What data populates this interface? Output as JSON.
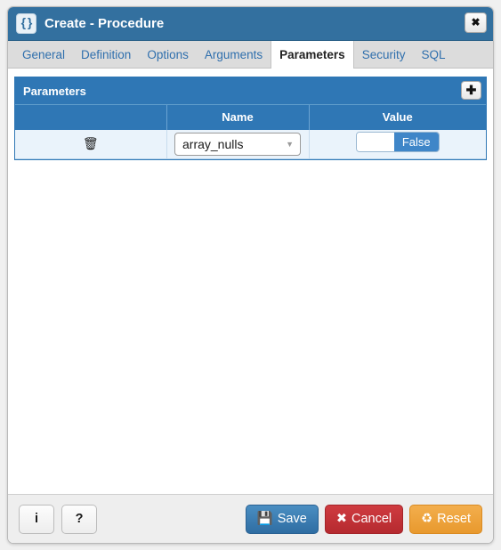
{
  "window": {
    "title": "Create - Procedure",
    "title_icon": "braces-icon",
    "title_icon_glyph": "{ }",
    "close_label": "✖"
  },
  "tabs": [
    {
      "label": "General",
      "active": false
    },
    {
      "label": "Definition",
      "active": false
    },
    {
      "label": "Options",
      "active": false
    },
    {
      "label": "Arguments",
      "active": false
    },
    {
      "label": "Parameters",
      "active": true
    },
    {
      "label": "Security",
      "active": false
    },
    {
      "label": "SQL",
      "active": false
    }
  ],
  "panel": {
    "title": "Parameters",
    "add_label": "✚"
  },
  "grid": {
    "columns": [
      "",
      "Name",
      "Value"
    ],
    "rows": [
      {
        "delete_icon": "🗑",
        "name": "array_nulls",
        "caret": "▼",
        "value_selected": "False",
        "value_unselected": ""
      }
    ]
  },
  "footer": {
    "info_label": "i",
    "help_label": "?",
    "save_label": "Save",
    "save_icon": "💾",
    "cancel_label": "Cancel",
    "cancel_icon": "✖",
    "reset_label": "Reset",
    "reset_icon": "♻"
  },
  "colors": {
    "titlebar_blue": "#33709f",
    "panel_blue": "#2f77b5",
    "row_blue": "#eaf3fb",
    "save_blue": "#3b7eb4",
    "cancel_red": "#c33438",
    "reset_orange": "#eda03a",
    "tab_link": "#2f6fad"
  }
}
